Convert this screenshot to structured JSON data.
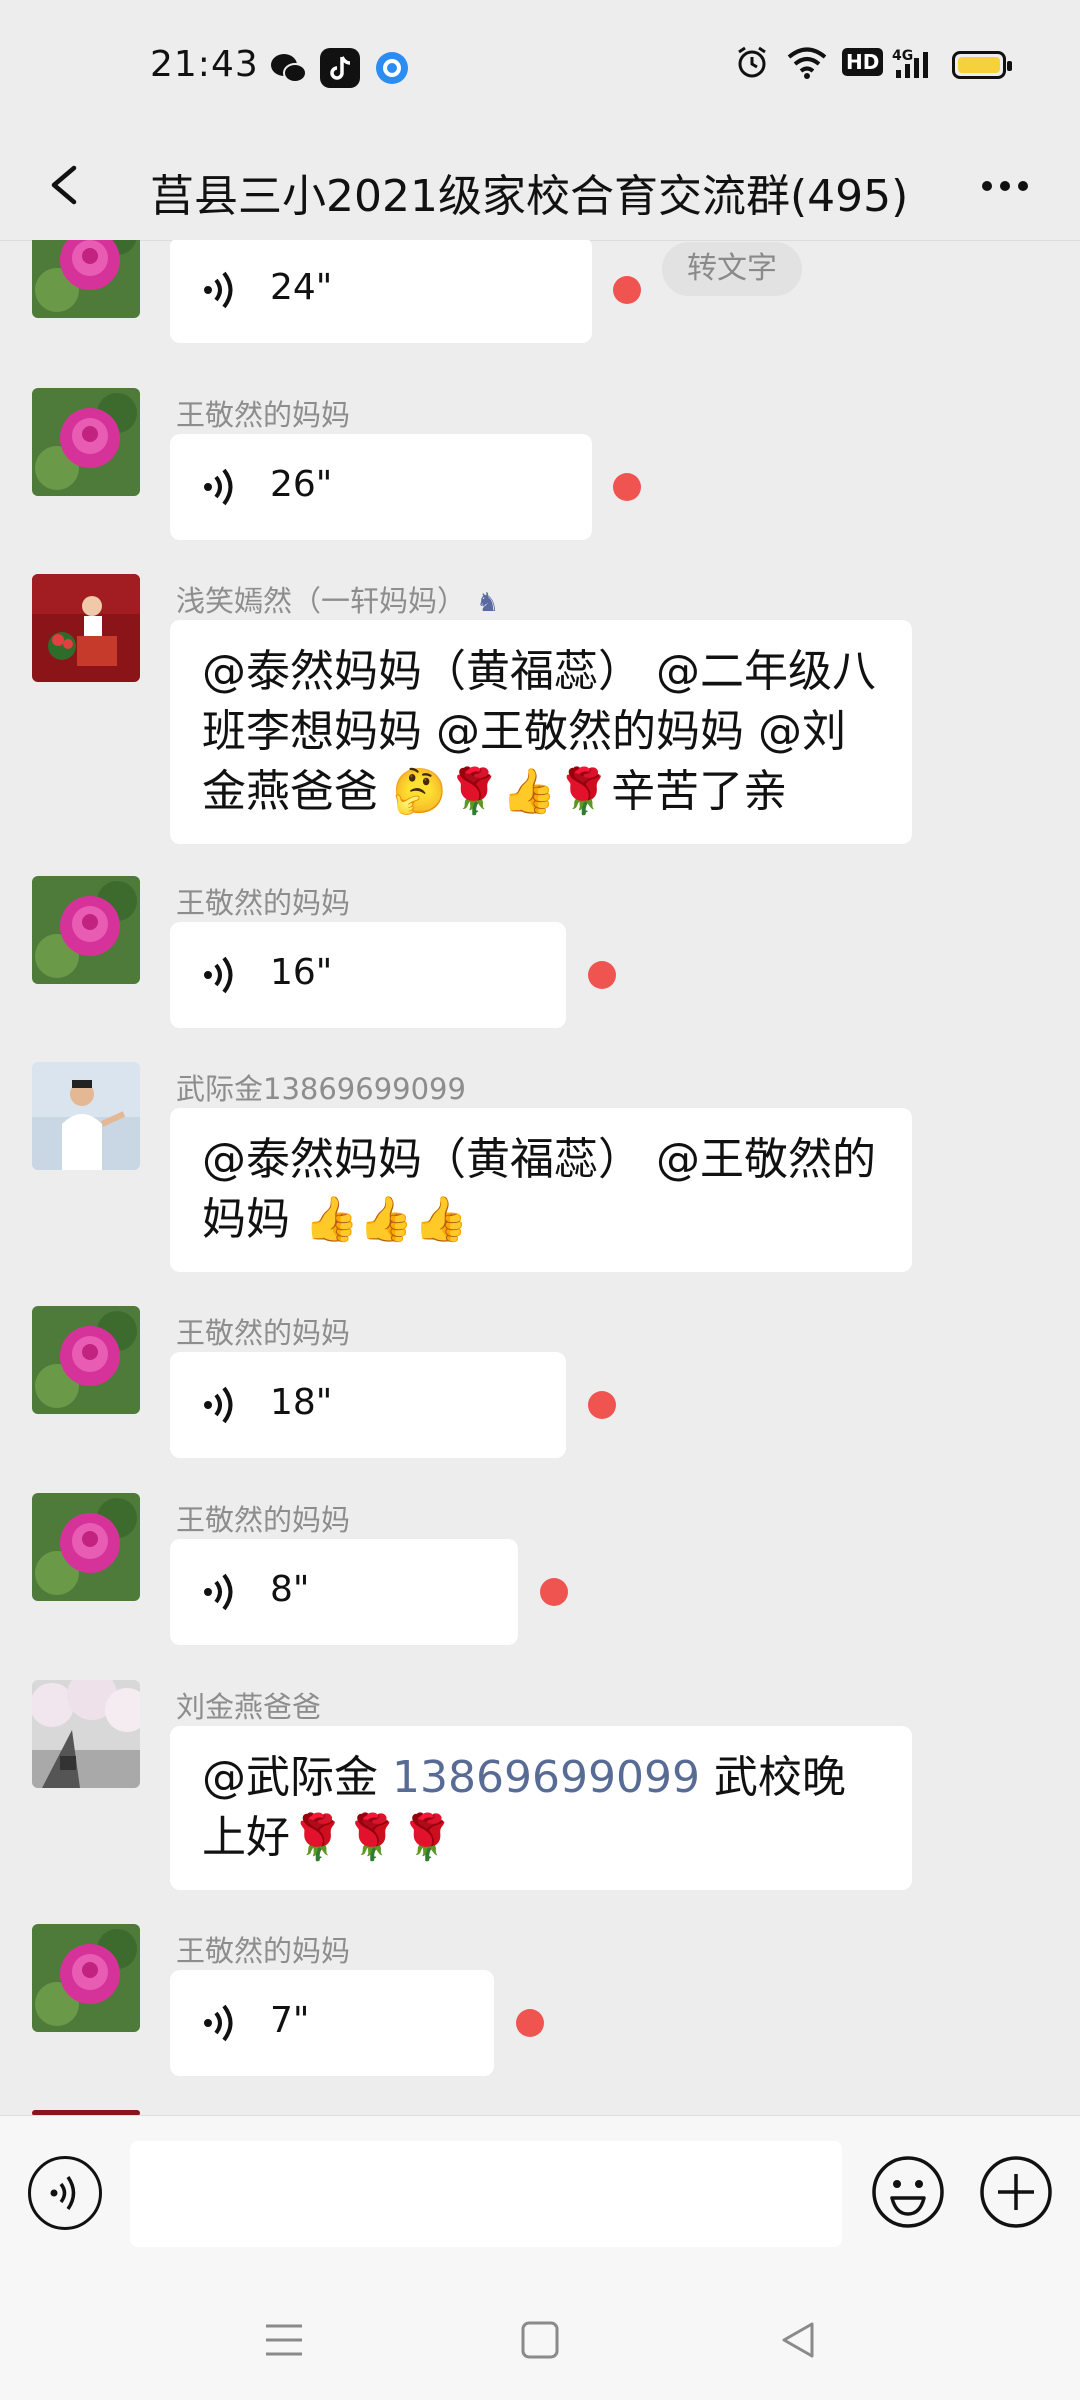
{
  "status": {
    "time": "21:43",
    "hd_label": "HD",
    "net_label": "4G",
    "colors": {
      "battery": "#f5d23b"
    }
  },
  "header": {
    "title": "莒县三小2021级家校合育交流群(495)"
  },
  "messages": [
    {
      "type": "voice",
      "sender": "",
      "duration": "24\"",
      "unread": true,
      "to_text_label": "转文字"
    },
    {
      "type": "voice",
      "sender": "王敬然的妈妈",
      "duration": "26\"",
      "unread": true
    },
    {
      "type": "text",
      "sender": "浅笑嫣然（一轩妈妈）",
      "text": "@泰然妈妈（黄福蕊） @二年级八班李想妈妈 @王敬然的妈妈 @刘金燕爸爸 🤔🌹👍🌹辛苦了亲"
    },
    {
      "type": "voice",
      "sender": "王敬然的妈妈",
      "duration": "16\"",
      "unread": true
    },
    {
      "type": "text",
      "sender": "武际金13869699099",
      "text": "@泰然妈妈（黄福蕊） @王敬然的妈妈 👍👍👍"
    },
    {
      "type": "voice",
      "sender": "王敬然的妈妈",
      "duration": "18\"",
      "unread": true
    },
    {
      "type": "voice",
      "sender": "王敬然的妈妈",
      "duration": "8\"",
      "unread": true
    },
    {
      "type": "text",
      "sender": "刘金燕爸爸",
      "text_prefix": "@武际金 ",
      "text_number": "13869699099",
      "text_suffix": " 武校晚上好🌹🌹🌹"
    },
    {
      "type": "voice",
      "sender": "王敬然的妈妈",
      "duration": "7\"",
      "unread": true
    }
  ],
  "input": {
    "placeholder": ""
  },
  "colors": {
    "background": "#ededed",
    "bubble": "#ffffff",
    "unread_dot": "#f05451",
    "mention_number": "#576b95"
  }
}
